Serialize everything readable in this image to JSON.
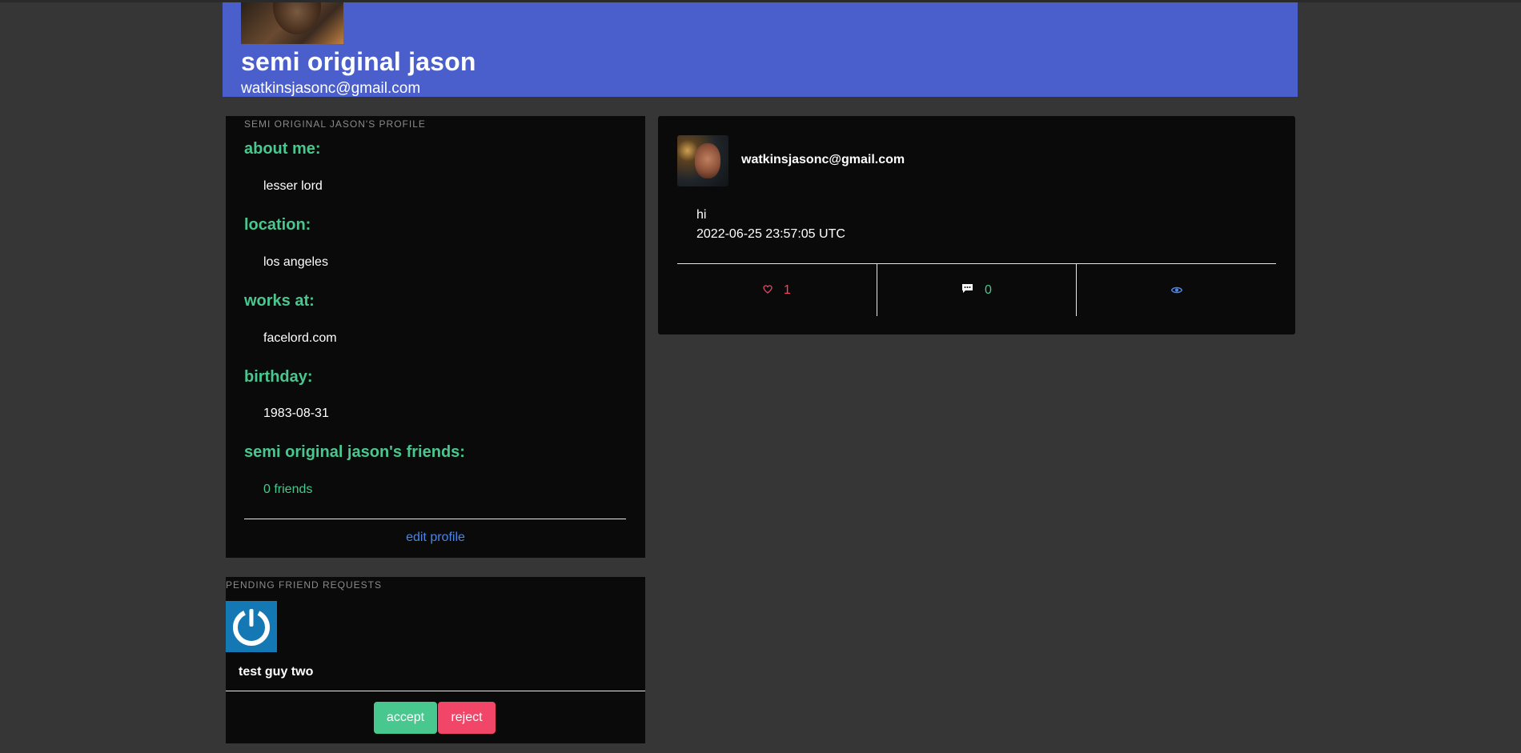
{
  "header": {
    "name": "semi original jason",
    "email": "watkinsjasonc@gmail.com"
  },
  "profile": {
    "title": "SEMI ORIGINAL JASON'S PROFILE",
    "about_label": "about me:",
    "about_value": "lesser lord",
    "location_label": "location:",
    "location_value": "los angeles",
    "works_label": "works at:",
    "works_value": "facelord.com",
    "birthday_label": "birthday:",
    "birthday_value": "1983-08-31",
    "friends_label": "semi original jason's friends:",
    "friends_value": "0 friends",
    "edit_label": "edit profile"
  },
  "requests": {
    "title": "PENDING FRIEND REQUESTS",
    "items": [
      {
        "name": "test guy two",
        "accept_label": "accept",
        "reject_label": "reject"
      }
    ]
  },
  "post": {
    "author": "watkinsjasonc@gmail.com",
    "text": "hi",
    "timestamp": "2022-06-25 23:57:05 UTC",
    "likes": "1",
    "comments": "0"
  },
  "colors": {
    "header_bg": "#4a5fcb",
    "accent_green": "#48c78e",
    "accent_red": "#f14668",
    "link_blue": "#4a86e8",
    "page_bg": "#363636",
    "card_bg": "#0a0a0a"
  },
  "icons": {
    "like": "heart-icon",
    "comment": "comment-icon",
    "view": "eye-icon",
    "request_avatar": "power-icon"
  }
}
